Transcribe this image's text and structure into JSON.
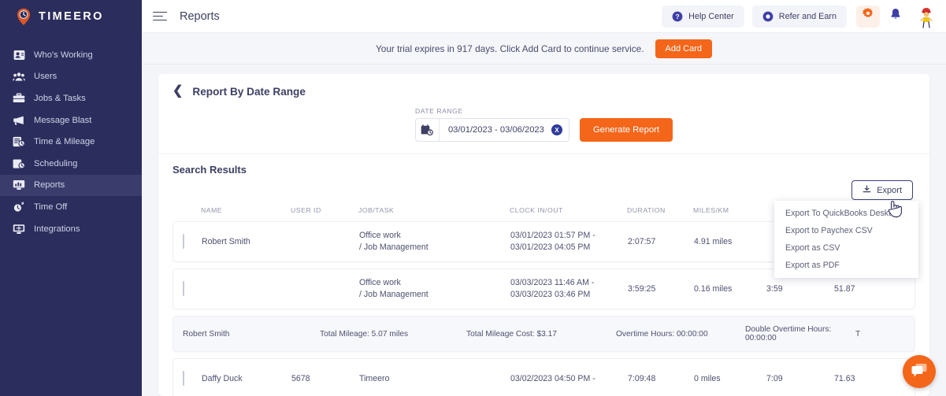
{
  "brand": {
    "name": "TIMEERO",
    "logo_icon": "clock-pin-icon"
  },
  "sidebar": {
    "items": [
      {
        "label": "Who's Working",
        "icon": "user-card-icon",
        "active": false
      },
      {
        "label": "Users",
        "icon": "users-icon",
        "active": false
      },
      {
        "label": "Jobs & Tasks",
        "icon": "briefcase-icon",
        "active": false
      },
      {
        "label": "Message Blast",
        "icon": "megaphone-icon",
        "active": false
      },
      {
        "label": "Time & Mileage",
        "icon": "time-mileage-icon",
        "active": false
      },
      {
        "label": "Scheduling",
        "icon": "calendar-clock-icon",
        "active": false
      },
      {
        "label": "Reports",
        "icon": "report-monitor-icon",
        "active": true
      },
      {
        "label": "Time Off",
        "icon": "time-off-icon",
        "active": false
      },
      {
        "label": "Integrations",
        "icon": "integrations-monitor-icon",
        "active": false
      }
    ]
  },
  "topbar": {
    "menu_icon": "hamburger-icon",
    "title": "Reports",
    "help_center": {
      "label": "Help Center",
      "icon": "question-circle-icon"
    },
    "refer_and_earn": {
      "label": "Refer and Earn",
      "icon": "refer-circle-icon"
    },
    "settings_icon": "gear-icon",
    "notifications_icon": "bell-icon",
    "avatar_icon": "avatar-icon"
  },
  "trial_banner": {
    "message": "Your trial expires in 917 days. Click Add Card to continue service.",
    "button_label": "Add Card"
  },
  "report": {
    "back_icon": "chevron-left-icon",
    "title": "Report By Date Range",
    "date_range": {
      "label": "DATE RANGE",
      "calendar_icon": "calendar-icon",
      "value": "03/01/2023 - 03/06/2023",
      "clear_label": "X"
    },
    "generate_button": "Generate Report"
  },
  "results": {
    "title": "Search Results",
    "export_button": {
      "label": "Export",
      "icon": "download-icon"
    },
    "export_menu": [
      "Export To QuickBooks Desktop",
      "Export to Paychex CSV",
      "Export as CSV",
      "Export as PDF"
    ],
    "columns": [
      "NAME",
      "USER ID",
      "JOB/TASK",
      "CLOCK IN/OUT",
      "DURATION",
      "MILES/KM"
    ],
    "rows": [
      {
        "name": "Robert Smith",
        "user_id": "",
        "job_line1": "Office work",
        "job_line2": "/ Job Management",
        "clock_line1": "03/01/2023 01:57 PM -",
        "clock_line2": "03/01/2023 04:05 PM",
        "duration": "2:07:57",
        "miles": "4.91 miles",
        "extra1": "",
        "extra2": ""
      },
      {
        "name": "",
        "user_id": "",
        "job_line1": "Office work",
        "job_line2": "/ Job Management",
        "clock_line1": "03/03/2023 11:46 AM -",
        "clock_line2": "03/03/2023 03:46 PM",
        "duration": "3:59:25",
        "miles": "0.16 miles",
        "extra1": "3:59",
        "extra2": "51.87"
      }
    ],
    "summary": {
      "name": "Robert Smith",
      "total_mileage": "Total Mileage: 5.07 miles",
      "total_mileage_cost": "Total Mileage Cost: $3.17",
      "overtime_hours": "Overtime Hours: 00:00:00",
      "double_overtime_hours": "Double Overtime Hours: 00:00:00",
      "truncated": "T"
    },
    "partial_row": {
      "name": "Daffy Duck",
      "user_id": "5678",
      "job": "Timeero",
      "clock": "03/02/2023 04:50 PM -",
      "duration": "7:09:48",
      "miles": "0 miles",
      "extra1": "7:09",
      "extra2": "71.63"
    }
  },
  "chat_widget": {
    "icon": "chat-bubble-icon"
  },
  "colors": {
    "sidebar_bg": "#2b2d5c",
    "sidebar_active": "#3a3c6b",
    "accent_orange": "#f4661a",
    "navy_text": "#3d3f63",
    "page_bg": "#f4f5f9"
  }
}
